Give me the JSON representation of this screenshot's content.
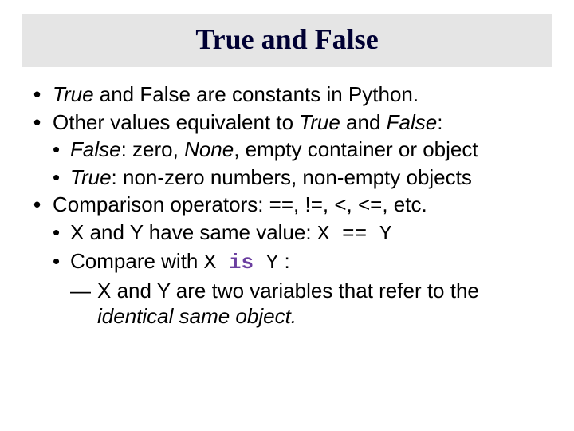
{
  "title": "True and False",
  "b1_true": "True",
  "b1_rest": " and False are constants in Python.",
  "b2_pre": "Other values equivalent to ",
  "b2_true": "True",
  "b2_and": " and ",
  "b2_false": "False",
  "b2_colon": ":",
  "b2a_false": "False",
  "b2a_mid": ": zero, ",
  "b2a_none": "None",
  "b2a_rest": ", empty container or object",
  "b2b_true": "True",
  "b2b_rest": ": non-zero numbers, non-empty objects",
  "b3": "Comparison operators: ==, !=, <, <=, etc.",
  "b3a_text": "X and Y have same value:  ",
  "b3a_code": "X == Y",
  "b3b_text": "Compare with  ",
  "b3b_x": "X ",
  "b3b_is": "is",
  "b3b_y": " Y",
  "b3b_colon": " :",
  "b3c_pre": "X and Y are two variables that refer to the ",
  "b3c_em": "identical same object.",
  "colors": {
    "title_bg": "#e5e5e5",
    "title_fg": "#000033",
    "keyword": "#6b3fa0"
  }
}
